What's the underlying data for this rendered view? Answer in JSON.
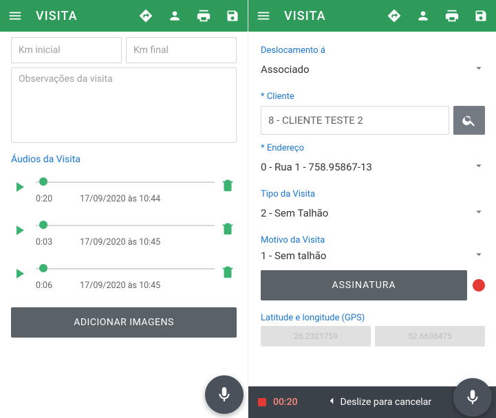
{
  "appbar": {
    "title": "VISITA"
  },
  "left": {
    "km_inicial_placeholder": "Km inicial",
    "km_final_placeholder": "Km final",
    "obs_placeholder": "Observações da visita",
    "audios_label": "Áudios da Visita",
    "audios": [
      {
        "duration": "0:20",
        "timestamp": "17/09/2020 às 10:44",
        "progress": 0.02
      },
      {
        "duration": "0:03",
        "timestamp": "17/09/2020 às 10:45",
        "progress": 0.02
      },
      {
        "duration": "0:06",
        "timestamp": "17/09/2020 às 10:45",
        "progress": 0.02
      }
    ],
    "add_images_button": "ADICIONAR IMAGENS"
  },
  "right": {
    "deslocamento_label": "Deslocamento á",
    "deslocamento_value": "Associado",
    "cliente_label": "* Cliente",
    "cliente_value": "8 - CLIENTE TESTE 2",
    "endereco_label": "* Endereço",
    "endereco_value": "0 - Rua 1 - 758.95867-13",
    "tipo_label": "Tipo da Visita",
    "tipo_value": "2 - Sem Talhão",
    "motivo_label": "Motivo da Visita",
    "motivo_value": "1 - Sem talhão",
    "assinatura_button": "ASSINATURA",
    "gps_label": "Latitude e longitude (GPS)",
    "gps_lat": "26.2321759",
    "gps_lon": "52.6638475",
    "rec_time": "00:20",
    "rec_cancel": "Deslize para cancelar"
  },
  "colors": {
    "primary": "#2e9b5b",
    "accent": "#3cb371",
    "link": "#1976d2",
    "button": "#5a6268",
    "fab": "#4a515a",
    "danger": "#e53935"
  }
}
